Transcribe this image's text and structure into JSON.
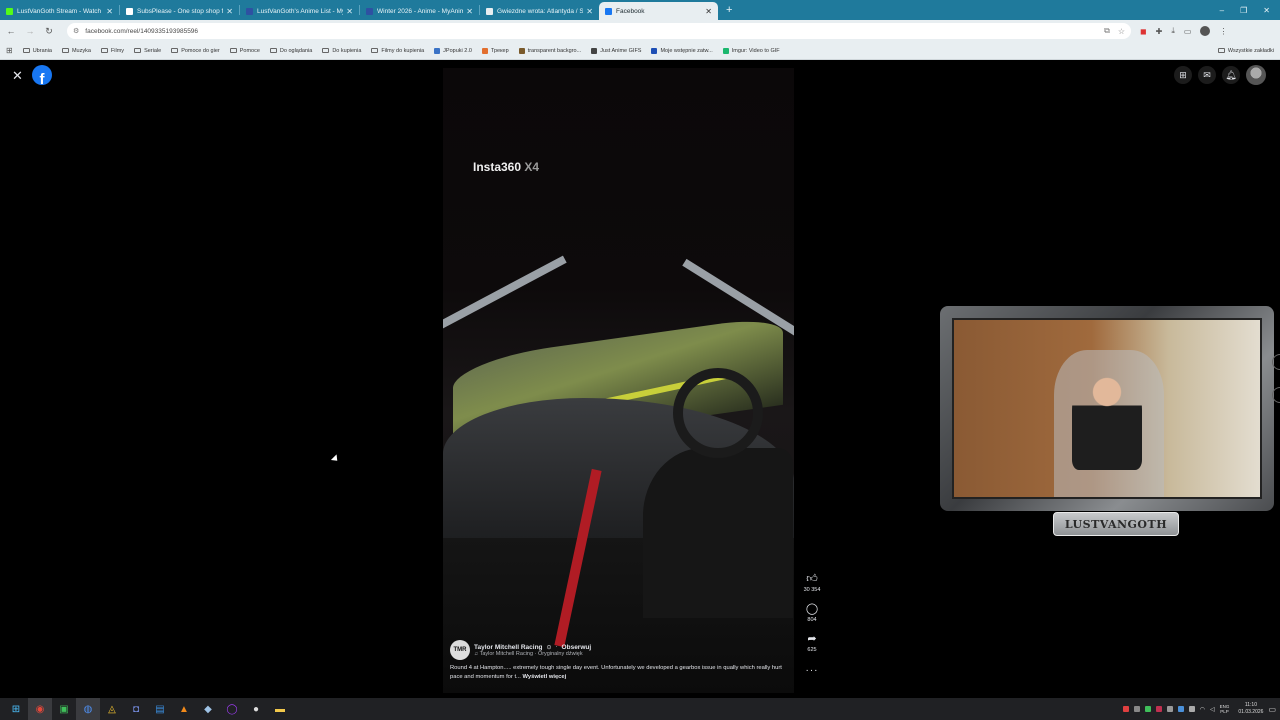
{
  "browser": {
    "tabs": [
      {
        "title": "LustVanGoth Stream - Watch Li",
        "color": "#53fc18",
        "active": false
      },
      {
        "title": "SubsPlease - One stop shop fo",
        "color": "#ffffff",
        "active": false
      },
      {
        "title": "LustVanGoth's Anime List - My",
        "color": "#2e51a2",
        "active": false
      },
      {
        "title": "Winter 2026 - Anime - MyAnim",
        "color": "#2e51a2",
        "active": false
      },
      {
        "title": "Gwiezdne wrota: Atlantyda / St",
        "color": "#e8eef1",
        "active": false
      },
      {
        "title": "Facebook",
        "color": "#1877f2",
        "active": true
      }
    ],
    "new_tab": "+",
    "window_controls": [
      "–",
      "❐",
      "✕"
    ],
    "url": "facebook.com/reel/1409335193985596",
    "bookmarks": [
      {
        "label": "Ubrania",
        "type": "folder"
      },
      {
        "label": "Muzyka",
        "type": "folder"
      },
      {
        "label": "Filmy",
        "type": "folder"
      },
      {
        "label": "Seriale",
        "type": "folder"
      },
      {
        "label": "Pomoce do gier",
        "type": "folder"
      },
      {
        "label": "Pomoce",
        "type": "folder"
      },
      {
        "label": "Do oglądania",
        "type": "folder"
      },
      {
        "label": "Do kupienia",
        "type": "folder"
      },
      {
        "label": "Filmy do kupienia",
        "type": "folder"
      },
      {
        "label": "JPopuki 2.0",
        "type": "site",
        "color": "#3b73c6"
      },
      {
        "label": "Трекер",
        "type": "site",
        "color": "#e26f2f"
      },
      {
        "label": "transparent backgro...",
        "type": "site",
        "color": "#7a5a2b"
      },
      {
        "label": "Just Anime GIFS",
        "type": "site",
        "color": "#444444"
      },
      {
        "label": "Moje wstępnie zatw...",
        "type": "site",
        "color": "#1e4fb5"
      },
      {
        "label": "Imgur: Video to GIF",
        "type": "site",
        "color": "#1bb76e"
      }
    ],
    "all_bookmarks": "Wszystkie zakładki"
  },
  "reel": {
    "watermark_brand": "Insta360",
    "watermark_model": "X4",
    "likes": "30 354",
    "comments": "804",
    "shares": "625",
    "page_name": "Taylor Mitchell Racing",
    "follow_label": "Obserwuj",
    "audio": "Taylor Mitchell Racing · Oryginalny dźwięk",
    "description": "Round 4 at Hampton..... extremely tough single day event. Unfortunately we developed a gearbox issue in qually which really hurt pace and momentum for t...",
    "see_more": "Wyświetl więcej",
    "page_avatar_text": "TMR"
  },
  "overlay": {
    "streamer_name": "LUSTVANGOTH"
  },
  "taskbar": {
    "lang_top": "ENG",
    "lang_bottom": "PLP",
    "time": "11:10",
    "date": "01.03.2026"
  }
}
